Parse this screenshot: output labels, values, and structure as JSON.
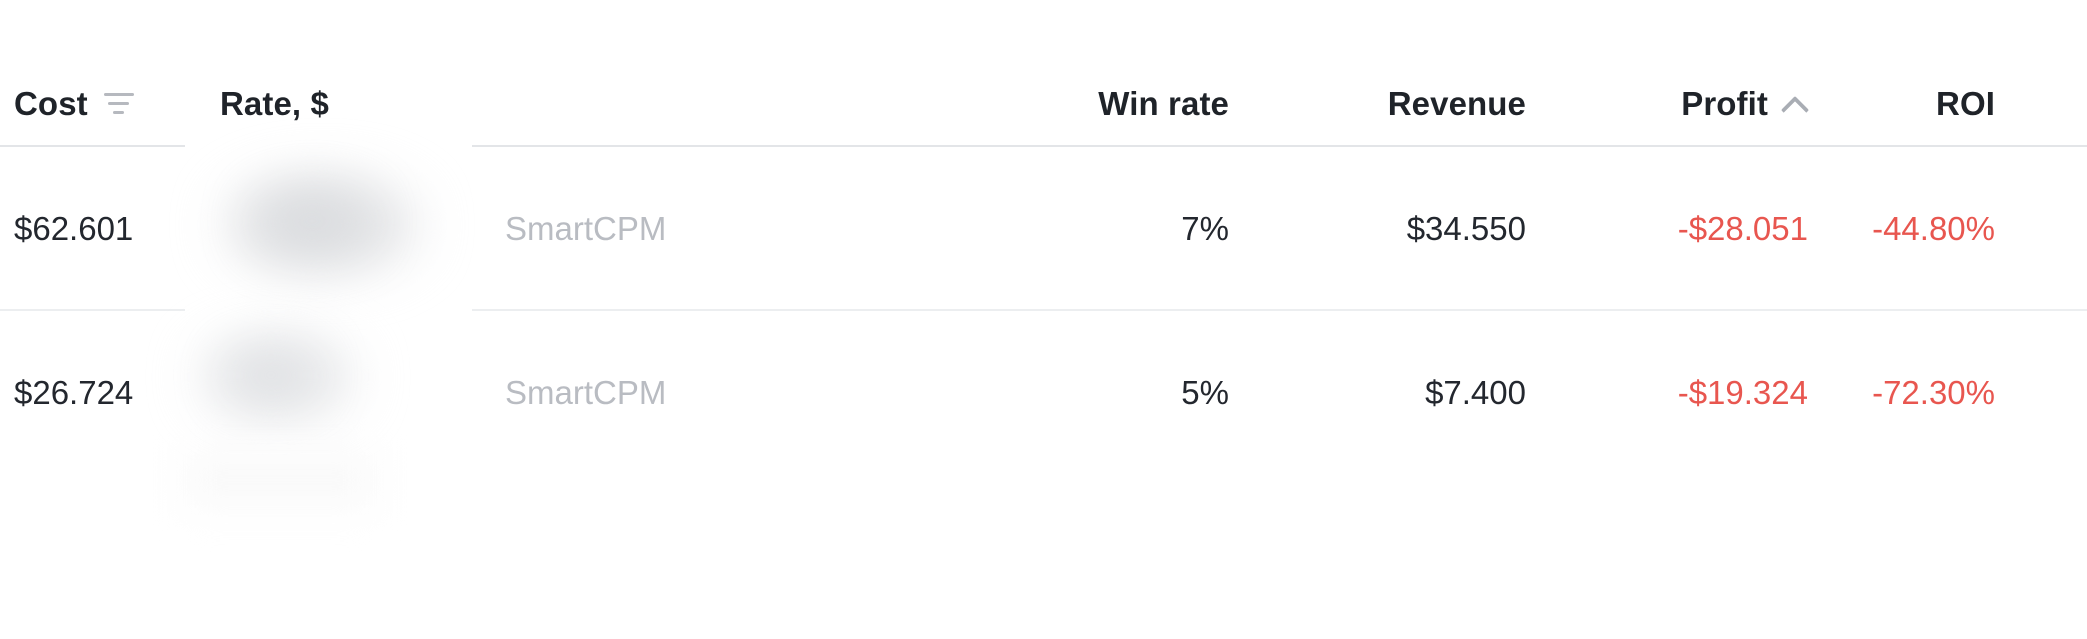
{
  "table": {
    "columns": [
      {
        "key": "cost",
        "label": "Cost",
        "align": "left",
        "icon": "filter-icon"
      },
      {
        "key": "rate",
        "label": "Rate, $",
        "align": "left",
        "icon": null
      },
      {
        "key": "method",
        "label": "",
        "align": "left",
        "icon": null
      },
      {
        "key": "win_rate",
        "label": "Win rate",
        "align": "right",
        "icon": null
      },
      {
        "key": "revenue",
        "label": "Revenue",
        "align": "right",
        "icon": null
      },
      {
        "key": "profit",
        "label": "Profit",
        "align": "right",
        "icon": "chevron-up-icon"
      },
      {
        "key": "roi",
        "label": "ROI",
        "align": "right",
        "icon": null
      }
    ],
    "rows": [
      {
        "cost": "$62.601",
        "rate": "",
        "method": "SmartCPM",
        "win_rate": "7%",
        "revenue": "$34.550",
        "profit": "-$28.051",
        "roi": "-44.80%"
      },
      {
        "cost": "$26.724",
        "rate": "",
        "method": "SmartCPM",
        "win_rate": "5%",
        "revenue": "$7.400",
        "profit": "-$19.324",
        "roi": "-72.30%"
      }
    ]
  },
  "colors": {
    "text": "#23272e",
    "header_text": "#1f2329",
    "muted": "#b9bcc2",
    "negative": "#e8564f",
    "rule": "#e3e5e8"
  }
}
